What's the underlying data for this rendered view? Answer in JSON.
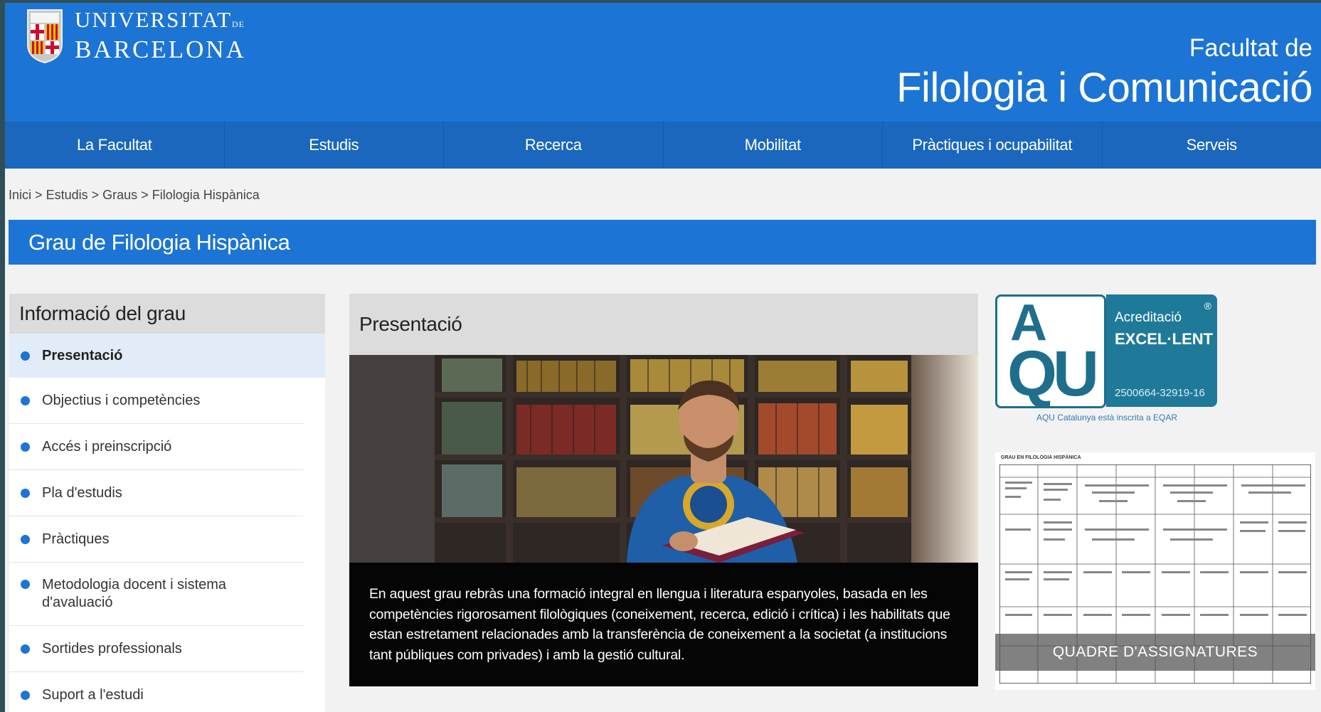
{
  "header": {
    "logo_line1": "UNIVERSITAT",
    "logo_line1_small": "DE",
    "logo_line2": "BARCELONA",
    "faculty_small": "Facultat de",
    "faculty_big": "Filologia i Comunicació"
  },
  "nav": [
    {
      "label": "La Facultat"
    },
    {
      "label": "Estudis"
    },
    {
      "label": "Recerca"
    },
    {
      "label": "Mobilitat"
    },
    {
      "label": "Pràctiques i ocupabilitat"
    },
    {
      "label": "Serveis"
    }
  ],
  "breadcrumb": {
    "items": [
      "Inici",
      "Estudis",
      "Graus",
      "Filologia Hispànica"
    ],
    "separator": ">"
  },
  "page_title": "Grau de Filologia Hispànica",
  "sidebar": {
    "title": "Informació del grau",
    "items": [
      {
        "label": "Presentació",
        "active": true
      },
      {
        "label": "Objectius i competències"
      },
      {
        "label": "Accés i preinscripció"
      },
      {
        "label": "Pla d'estudis"
      },
      {
        "label": "Pràctiques"
      },
      {
        "label": "Metodologia docent i sistema d'avaluació"
      },
      {
        "label": "Sortides professionals"
      },
      {
        "label": "Suport a l'estudi"
      }
    ]
  },
  "main": {
    "title": "Presentació",
    "photo_alt": "student-reading-in-library",
    "caption": "En aquest grau rebràs una formació integral en llengua i literatura espanyoles, basada en les competències rigorosament filològiques (coneixement, recerca, edició i crítica) i les habilitats que estan estretament relacionades amb la transferència de coneixement a la societat (a institucions tant públiques com privades) i amb la gestió cultural."
  },
  "aqu": {
    "letters_top": "A",
    "letters_bottom": "QU",
    "label1": "Acreditació",
    "label2": "EXCEL·LENT",
    "code": "2500664-32919-16",
    "registered": "®",
    "note": "AQU Catalunya està inscrita a EQAR"
  },
  "course_table": {
    "title": "GRAU EN FILOLOGIA HISPÀNICA",
    "label": "QUADRE D'ASSIGNATURES"
  },
  "colors": {
    "brand_blue": "#1c74d4",
    "nav_blue": "#1a67bd",
    "aqu_teal": "#1f7a9a"
  }
}
